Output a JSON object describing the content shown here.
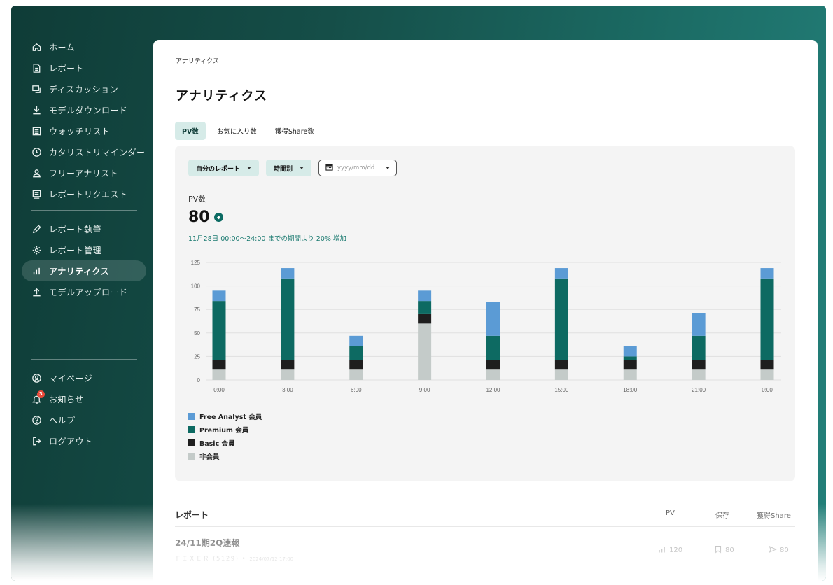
{
  "sidebar": {
    "main_items": [
      {
        "label": "ホーム",
        "icon": "home-icon"
      },
      {
        "label": "レポート",
        "icon": "document-icon"
      },
      {
        "label": "ディスカッション",
        "icon": "chat-icon"
      },
      {
        "label": "モデルダウンロード",
        "icon": "download-icon"
      },
      {
        "label": "ウォッチリスト",
        "icon": "list-icon"
      },
      {
        "label": "カタリストリマインダー",
        "icon": "clock-icon"
      },
      {
        "label": "フリーアナリスト",
        "icon": "person-icon"
      },
      {
        "label": "レポートリクエスト",
        "icon": "request-icon"
      }
    ],
    "author_items": [
      {
        "label": "レポート執筆",
        "icon": "pen-icon"
      },
      {
        "label": "レポート管理",
        "icon": "gear-icon"
      },
      {
        "label": "アナリティクス",
        "icon": "analytics-icon",
        "active": true
      },
      {
        "label": "モデルアップロード",
        "icon": "upload-icon"
      }
    ],
    "account_items": [
      {
        "label": "マイページ",
        "icon": "user-circle-icon"
      },
      {
        "label": "お知らせ",
        "icon": "bell-icon",
        "badge": "3"
      },
      {
        "label": "ヘルプ",
        "icon": "help-icon"
      },
      {
        "label": "ログアウト",
        "icon": "logout-icon"
      }
    ]
  },
  "main": {
    "breadcrumb": "アナリティクス",
    "title": "アナリティクス",
    "tabs": [
      {
        "label": "PV数",
        "active": true
      },
      {
        "label": "お気に入り数"
      },
      {
        "label": "獲得Share数"
      }
    ],
    "filters": {
      "report_select": "自分のレポート",
      "period_select": "時間別",
      "date_placeholder": "yyyy/mm/dd"
    },
    "metric": {
      "label": "PV数",
      "value": "80",
      "note": "11月28日 00:00〜24:00 までの期間より 20% 増加"
    }
  },
  "chart_data": {
    "type": "bar",
    "stacked": true,
    "categories": [
      "0:00",
      "3:00",
      "6:00",
      "9:00",
      "12:00",
      "15:00",
      "18:00",
      "21:00",
      "0:00"
    ],
    "series": [
      {
        "name": "非会員",
        "color": "#c4cbc9",
        "values": [
          11,
          11,
          11,
          60,
          11,
          11,
          11,
          11,
          11
        ]
      },
      {
        "name": "Basic 会員",
        "color": "#1e1e1e",
        "values": [
          10,
          10,
          10,
          10,
          10,
          10,
          10,
          10,
          10
        ]
      },
      {
        "name": "Premium 会員",
        "color": "#0d6a62",
        "values": [
          63,
          87,
          15,
          14,
          26,
          87,
          4,
          26,
          87
        ]
      },
      {
        "name": "Free Analyst 会員",
        "color": "#5b9bd5",
        "values": [
          11,
          11,
          11,
          11,
          36,
          11,
          11,
          24,
          11
        ]
      }
    ],
    "yticks": [
      0,
      25,
      50,
      75,
      100,
      125
    ],
    "ylim": [
      0,
      125
    ],
    "grid": true,
    "legend_position": "bottom-left"
  },
  "reports": {
    "title": "レポート",
    "columns": [
      "PV",
      "保存",
      "獲得Share"
    ],
    "rows": [
      {
        "title": "24/11期2Q速報",
        "company": "ＦＩＸＥＲ (5129)",
        "separator": "•",
        "date": "2024/07/12 17:00",
        "pv": "120",
        "saves": "80",
        "shares": "80"
      }
    ]
  }
}
